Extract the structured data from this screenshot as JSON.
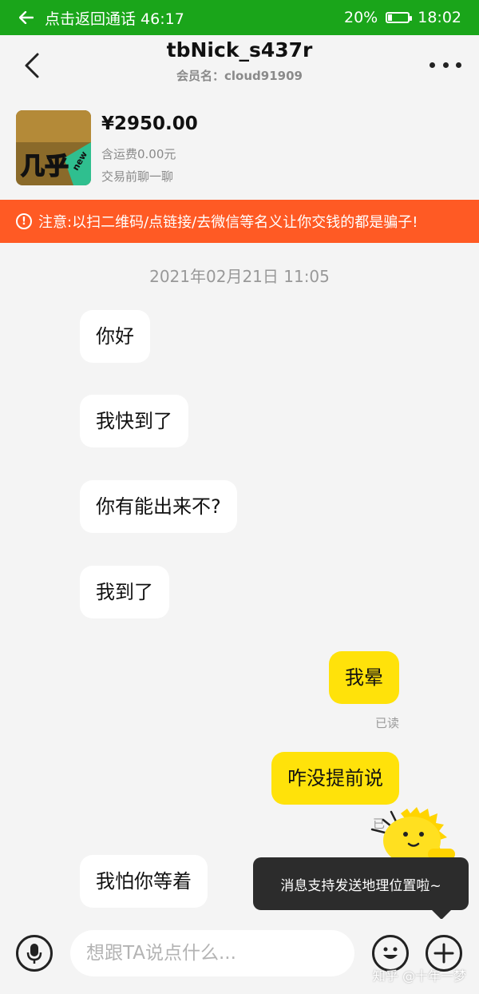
{
  "status_bar": {
    "call_text": "点击返回通话 46:17",
    "battery_pct": "20%",
    "battery_level": 0.2,
    "time": "18:02",
    "color": "#1aa51a"
  },
  "header": {
    "title": "tbNick_s437r",
    "member_label": "会员名：cloud91909",
    "back_icon": "chevron-left-icon",
    "more_icon": "more-dots-icon"
  },
  "product": {
    "thumb_text": "几乎",
    "thumb_badge": "new",
    "price": "¥2950.00",
    "shipping": "含运费0.00元",
    "chat_before": "交易前聊一聊"
  },
  "warning": {
    "icon": "!",
    "text": "注意:以扫二维码/点链接/去微信等名义让你交钱的都是骗子!",
    "color": "#ff5a24"
  },
  "chat": {
    "timestamp": "2021年02月21日 11:05",
    "messages": [
      {
        "side": "left",
        "text": "你好"
      },
      {
        "side": "left",
        "text": "我快到了"
      },
      {
        "side": "left",
        "text": "你有能出来不?"
      },
      {
        "side": "left",
        "text": "我到了"
      },
      {
        "side": "right",
        "text": "我晕",
        "status": "已读"
      },
      {
        "side": "right",
        "text": "咋没提前说",
        "status": "已"
      },
      {
        "side": "left",
        "text": "我怕你等着"
      }
    ],
    "bubble_color_right": "#ffe20a"
  },
  "tooltip": {
    "text": "消息支持发送地理位置啦~"
  },
  "input_bar": {
    "placeholder": "想跟TA说点什么...",
    "mic_icon": "microphone-icon",
    "emoji_icon": "emoji-icon",
    "plus_icon": "plus-icon"
  },
  "watermark": "知乎 @十年一梦"
}
